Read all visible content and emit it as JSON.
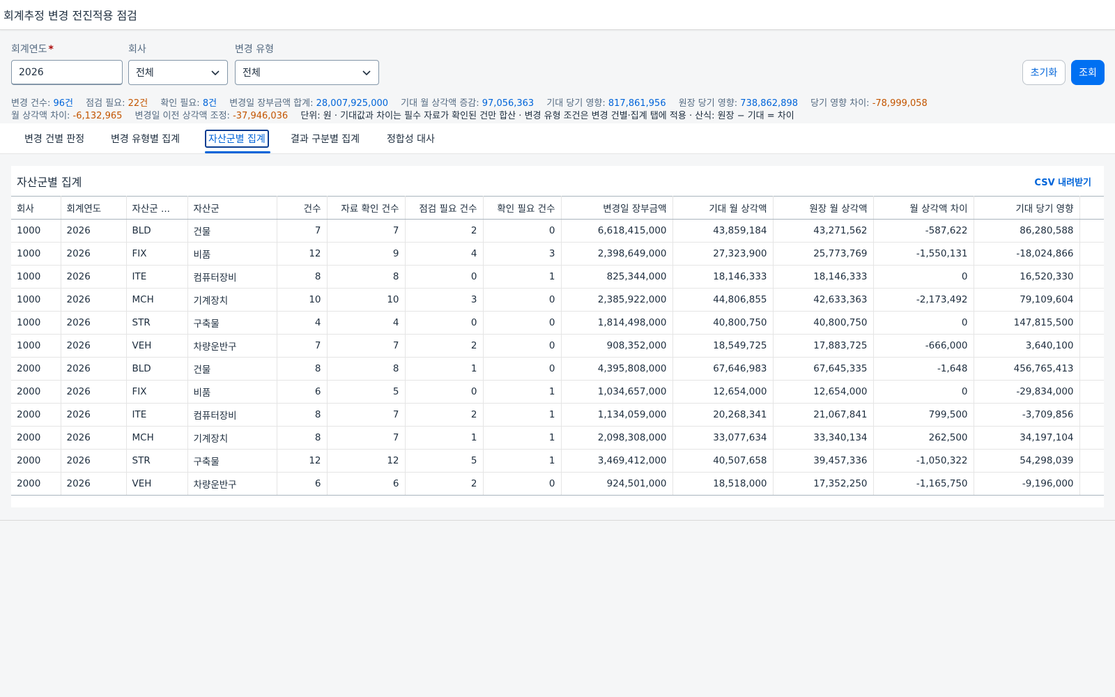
{
  "app": {
    "title": "회계추정 변경 전진적용 점검"
  },
  "filters": {
    "fiscal_year": {
      "label": "회계연도",
      "required_mark": "*",
      "value": "2026"
    },
    "company": {
      "label": "회사",
      "value": "전체"
    },
    "change_type": {
      "label": "변경 유형",
      "value": "전체"
    }
  },
  "buttons": {
    "reset": "초기화",
    "search": "조회"
  },
  "summary": {
    "change_count": {
      "label": "변경 건수:",
      "value": "96건"
    },
    "check_needed": {
      "label": "점검 필요:",
      "value": "22건"
    },
    "confirm_needed": {
      "label": "확인 필요:",
      "value": "8건"
    },
    "book_total": {
      "label": "변경일 장부금액 합계:",
      "value": "28,007,925,000"
    },
    "expected_monthly_increase": {
      "label": "기대 월 상각액 증감:",
      "value": "97,056,363"
    },
    "expected_current_effect": {
      "label": "기대 당기 영향:",
      "value": "817,861,956"
    },
    "ledger_current_effect": {
      "label": "원장 당기 영향:",
      "value": "738,862,898"
    },
    "current_effect_diff": {
      "label": "당기 영향 차이:",
      "value": "-78,999,058"
    },
    "monthly_diff": {
      "label": "월 상각액 차이:",
      "value": "-6,132,965"
    },
    "prior_adjustment": {
      "label": "변경일 이전 상각액 조정:",
      "value": "-37,946,036"
    },
    "note": "단위: 원 · 기대값과 차이는 필수 자료가 확인된 건만 합산 · 변경 유형 조건은 변경 건별·집계 탭에 적용 · 산식: 원장 − 기대 = 차이"
  },
  "tabs": [
    {
      "label": "변경 건별 판정"
    },
    {
      "label": "변경 유형별 집계"
    },
    {
      "label": "자산군별 집계",
      "active": true
    },
    {
      "label": "결과 구분별 집계"
    },
    {
      "label": "정합성 대사"
    }
  ],
  "panel": {
    "title": "자산군별 집계",
    "csv_label": "CSV 내려받기"
  },
  "table": {
    "columns": [
      "회사",
      "회계연도",
      "자산군 ...",
      "자산군",
      "건수",
      "자료 확인 건수",
      "점검 필요 건수",
      "확인 필요 건수",
      "변경일 장부금액",
      "기대 월 상각액",
      "원장 월 상각액",
      "월 상각액 차이",
      "기대 당기 영향"
    ],
    "rows": [
      [
        "1000",
        "2026",
        "BLD",
        "건물",
        "7",
        "7",
        "2",
        "0",
        "6,618,415,000",
        "43,859,184",
        "43,271,562",
        "-587,622",
        "86,280,588"
      ],
      [
        "1000",
        "2026",
        "FIX",
        "비품",
        "12",
        "9",
        "4",
        "3",
        "2,398,649,000",
        "27,323,900",
        "25,773,769",
        "-1,550,131",
        "-18,024,866"
      ],
      [
        "1000",
        "2026",
        "ITE",
        "컴퓨터장비",
        "8",
        "8",
        "0",
        "1",
        "825,344,000",
        "18,146,333",
        "18,146,333",
        "0",
        "16,520,330"
      ],
      [
        "1000",
        "2026",
        "MCH",
        "기계장치",
        "10",
        "10",
        "3",
        "0",
        "2,385,922,000",
        "44,806,855",
        "42,633,363",
        "-2,173,492",
        "79,109,604"
      ],
      [
        "1000",
        "2026",
        "STR",
        "구축물",
        "4",
        "4",
        "0",
        "0",
        "1,814,498,000",
        "40,800,750",
        "40,800,750",
        "0",
        "147,815,500"
      ],
      [
        "1000",
        "2026",
        "VEH",
        "차량운반구",
        "7",
        "7",
        "2",
        "0",
        "908,352,000",
        "18,549,725",
        "17,883,725",
        "-666,000",
        "3,640,100"
      ],
      [
        "2000",
        "2026",
        "BLD",
        "건물",
        "8",
        "8",
        "1",
        "0",
        "4,395,808,000",
        "67,646,983",
        "67,645,335",
        "-1,648",
        "456,765,413"
      ],
      [
        "2000",
        "2026",
        "FIX",
        "비품",
        "6",
        "5",
        "0",
        "1",
        "1,034,657,000",
        "12,654,000",
        "12,654,000",
        "0",
        "-29,834,000"
      ],
      [
        "2000",
        "2026",
        "ITE",
        "컴퓨터장비",
        "8",
        "7",
        "2",
        "1",
        "1,134,059,000",
        "20,268,341",
        "21,067,841",
        "799,500",
        "-3,709,856"
      ],
      [
        "2000",
        "2026",
        "MCH",
        "기계장치",
        "8",
        "7",
        "1",
        "1",
        "2,098,308,000",
        "33,077,634",
        "33,340,134",
        "262,500",
        "34,197,104"
      ],
      [
        "2000",
        "2026",
        "STR",
        "구축물",
        "12",
        "12",
        "5",
        "1",
        "3,469,412,000",
        "40,507,658",
        "39,457,336",
        "-1,050,322",
        "54,298,039"
      ],
      [
        "2000",
        "2026",
        "VEH",
        "차량운반구",
        "6",
        "6",
        "2",
        "0",
        "924,501,000",
        "18,518,000",
        "17,352,250",
        "-1,165,750",
        "-9,196,000"
      ]
    ]
  },
  "colors": {
    "accent": "#0064d9",
    "warning": "#c35500",
    "primary_button": "#0070f2"
  }
}
